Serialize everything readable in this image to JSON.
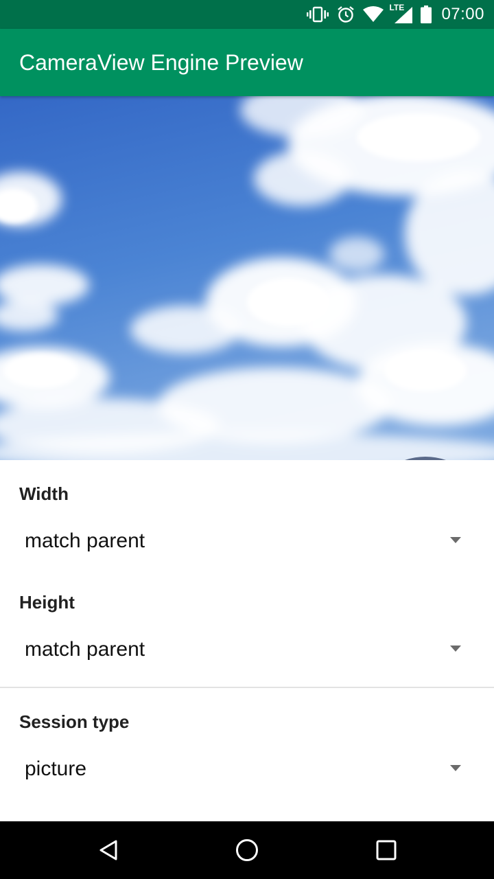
{
  "status_bar": {
    "time": "07:00",
    "network_label": "LTE",
    "icons": [
      "vibrate-icon",
      "alarm-icon",
      "wifi-icon",
      "cell-signal-icon",
      "battery-icon"
    ]
  },
  "app_bar": {
    "title": "CameraView Engine Preview",
    "color": "#00915f"
  },
  "settings": {
    "width": {
      "label": "Width",
      "value": "match parent"
    },
    "height": {
      "label": "Height",
      "value": "match parent"
    },
    "session_type": {
      "label": "Session type",
      "value": "picture"
    }
  },
  "nav_bar": {
    "icons": [
      "back-icon",
      "home-icon",
      "recents-icon"
    ]
  }
}
